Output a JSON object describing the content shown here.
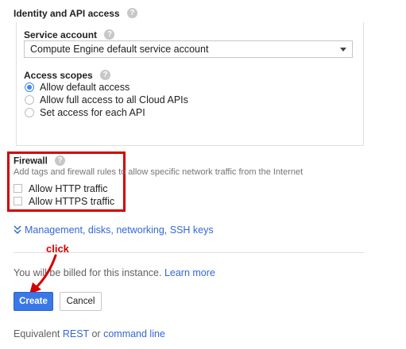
{
  "identity": {
    "title": "Identity and API access",
    "service_account_label": "Service account",
    "service_account_value": "Compute Engine default service account",
    "access_scopes_label": "Access scopes",
    "scopes": [
      {
        "label": "Allow default access",
        "checked": true
      },
      {
        "label": "Allow full access to all Cloud APIs",
        "checked": false
      },
      {
        "label": "Set access for each API",
        "checked": false
      }
    ]
  },
  "firewall": {
    "title": "Firewall",
    "description": "Add tags and firewall rules to allow specific network traffic from the Internet",
    "options": [
      {
        "label": "Allow HTTP traffic",
        "checked": false
      },
      {
        "label": "Allow HTTPS traffic",
        "checked": false
      }
    ]
  },
  "management_link": "Management, disks, networking, SSH keys",
  "annotation": {
    "click_label": "click"
  },
  "billing": {
    "text": "You will be billed for this instance.",
    "learn_more": "Learn more"
  },
  "actions": {
    "create": "Create",
    "cancel": "Cancel"
  },
  "equivalent": {
    "prefix": "Equivalent",
    "rest": "REST",
    "or": "or",
    "command_line": "command line"
  },
  "help_glyph": "?",
  "colors": {
    "accent": "#3b78e7",
    "link": "#3367d6",
    "highlight": "#d40000"
  }
}
